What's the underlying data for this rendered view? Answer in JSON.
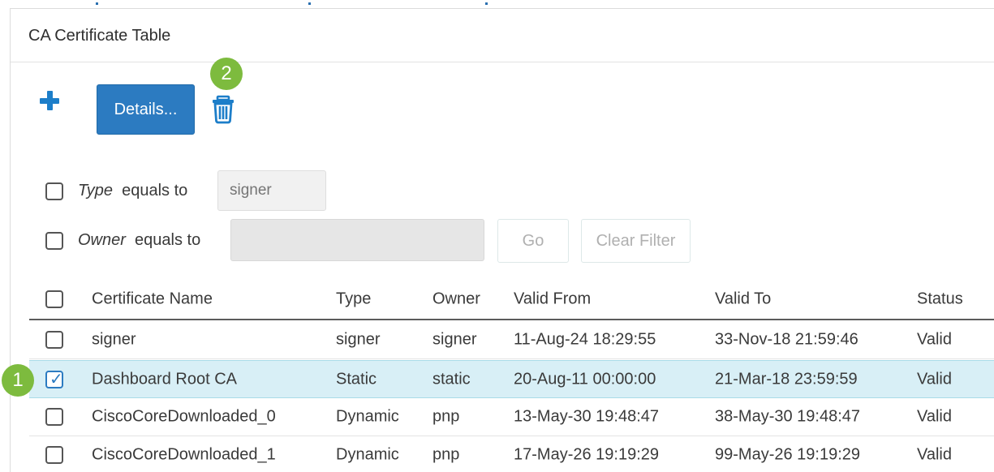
{
  "panel": {
    "title": "CA Certificate Table"
  },
  "toolbar": {
    "add_icon": "plus-icon",
    "details_label": "Details...",
    "delete_icon": "trash-icon"
  },
  "badges": {
    "step1": "1",
    "step2": "2"
  },
  "filters": {
    "type": {
      "field": "Type",
      "operator": "equals to",
      "value": "signer",
      "checked": false
    },
    "owner": {
      "field": "Owner",
      "operator": "equals to",
      "value": "",
      "checked": false
    },
    "go_label": "Go",
    "clear_label": "Clear Filter"
  },
  "table": {
    "columns": [
      "Certificate Name",
      "Type",
      "Owner",
      "Valid From",
      "Valid To",
      "Status"
    ],
    "rows": [
      {
        "name": "signer",
        "type": "signer",
        "owner": "signer",
        "valid_from": "11-Aug-24 18:29:55",
        "valid_to": "33-Nov-18 21:59:46",
        "status": "Valid",
        "checked": false
      },
      {
        "name": "Dashboard Root CA",
        "type": "Static",
        "owner": "static",
        "valid_from": "20-Aug-11 00:00:00",
        "valid_to": "21-Mar-18 23:59:59",
        "status": "Valid",
        "checked": true
      },
      {
        "name": "CiscoCoreDownloaded_0",
        "type": "Dynamic",
        "owner": "pnp",
        "valid_from": "13-May-30 19:48:47",
        "valid_to": "38-May-30 19:48:47",
        "status": "Valid",
        "checked": false
      },
      {
        "name": "CiscoCoreDownloaded_1",
        "type": "Dynamic",
        "owner": "pnp",
        "valid_from": "17-May-26 19:19:29",
        "valid_to": "99-May-26 19:19:29",
        "status": "Valid",
        "checked": false
      }
    ]
  },
  "colors": {
    "accent": "#2c7bc1",
    "badge": "#7dbb3e",
    "selected_row": "#d8eff6"
  }
}
